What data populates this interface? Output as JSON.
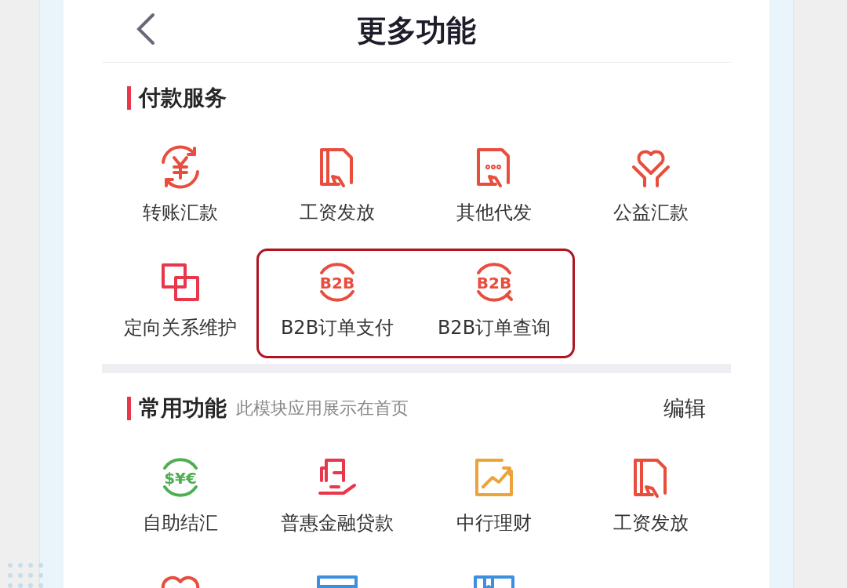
{
  "header": {
    "title": "更多功能"
  },
  "sections": [
    {
      "title": "付款服务",
      "rows": [
        [
          {
            "label": "转账汇款",
            "highlighted": false
          },
          {
            "label": "工资发放",
            "highlighted": false
          },
          {
            "label": "其他代发",
            "highlighted": false
          },
          {
            "label": "公益汇款",
            "highlighted": false
          }
        ],
        [
          {
            "label": "定向关系维护",
            "highlighted": false
          },
          {
            "label": "B2B订单支付",
            "icon_text": "B2B",
            "highlighted": true
          },
          {
            "label": "B2B订单查询",
            "icon_text": "B2B",
            "highlighted": true
          }
        ]
      ]
    },
    {
      "title": "常用功能",
      "subtitle": "此模块应用展示在首页",
      "action": "编辑",
      "rows": [
        [
          {
            "label": "自助结汇",
            "icon_text": "$¥€",
            "highlighted": false
          },
          {
            "label": "普惠金融贷款",
            "highlighted": false
          },
          {
            "label": "中行理财",
            "highlighted": false
          },
          {
            "label": "工资发放",
            "highlighted": false
          }
        ],
        [
          {},
          {},
          {}
        ]
      ]
    }
  ]
}
